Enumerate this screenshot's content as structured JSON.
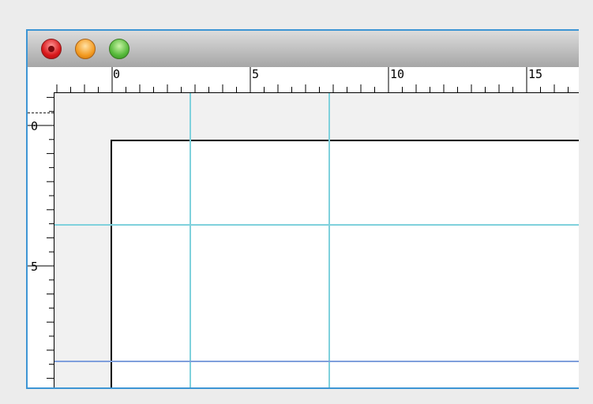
{
  "window": {
    "buttons": {
      "close": "close-button",
      "minimize": "minimize-button",
      "zoom": "zoom-button"
    }
  },
  "rulers": {
    "horizontal_labels": [
      "0",
      "5",
      "10",
      "15"
    ],
    "vertical_labels": [
      "0",
      "5"
    ]
  },
  "colors": {
    "window_border": "#3d95d4",
    "guide": "#7fd1dc",
    "margin_guide": "#7f9fdc"
  }
}
